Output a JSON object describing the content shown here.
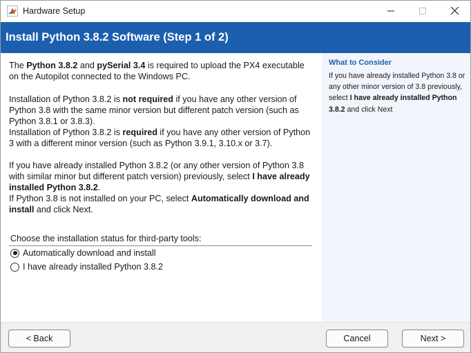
{
  "window": {
    "title": "Hardware Setup",
    "app_icon": "matlab-icon",
    "controls": [
      "minimize-icon",
      "maximize-icon",
      "close-icon"
    ]
  },
  "header": {
    "title": "Install Python 3.8.2 Software (Step 1 of 2)",
    "background": "#1c5fae"
  },
  "main": {
    "p1": {
      "t1": "The ",
      "b1": "Python 3.8.2",
      "t2": " and ",
      "b2": "pySerial 3.4",
      "t3": " is required to upload the PX4 executable on the Autopilot connected to the Windows PC."
    },
    "p2": {
      "t1": "Installation of Python 3.8.2 is ",
      "b1": "not required",
      "t2": " if you have any other version of Python 3.8 with the same minor version but different patch version (such as Python 3.8.1 or 3.8.3)."
    },
    "p3": {
      "t1": "Installation of Python 3.8.2 is ",
      "b1": "required",
      "t2": " if you have any other version of Python 3 with a different minor version (such as Python 3.9.1, 3.10.x or 3.7)."
    },
    "p4": {
      "t1": "If you have already installed Python 3.8.2 (or any other version of Python 3.8 with similar minor but different patch version) previously, select ",
      "b1": "I have already installed Python 3.8.2",
      "t2": "."
    },
    "p5": {
      "t1": "If Python 3.8 is not installed on your PC, select ",
      "b1": "Automatically download and install",
      "t2": " and click Next."
    },
    "choose_label": "Choose the installation status for third-party tools:",
    "options": [
      {
        "label": "Automatically download and install",
        "selected": true
      },
      {
        "label": "I have already installed Python 3.8.2",
        "selected": false
      }
    ]
  },
  "side": {
    "title": "What to Consider",
    "t1": "If you have already installed Python 3.8 or any other minor version of 3.8 previously, select ",
    "b1": "I have already installed Python 3.8.2",
    "t2": " and click Next",
    "background": "#f2f5fb",
    "title_color": "#1c5fae"
  },
  "footer": {
    "back_label": "< Back",
    "cancel_label": "Cancel",
    "next_label": "Next >"
  }
}
